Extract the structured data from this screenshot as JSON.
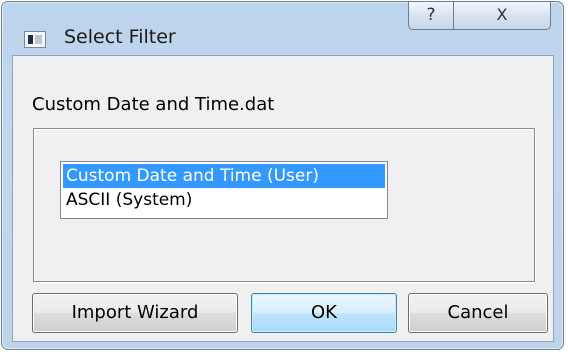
{
  "window": {
    "title": "Select Filter",
    "app_icon": "filter-window-icon",
    "help_glyph": "?",
    "close_glyph": "X"
  },
  "file_name": "Custom Date and Time.dat",
  "filters": {
    "items": [
      {
        "label": "Custom Date and Time (User)",
        "selected": true
      },
      {
        "label": "ASCII (System)",
        "selected": false
      }
    ]
  },
  "buttons": {
    "import_wizard": "Import Wizard",
    "ok": "OK",
    "cancel": "Cancel"
  },
  "colors": {
    "selection": "#3399ff",
    "default_button_border": "#3c7fb1"
  }
}
